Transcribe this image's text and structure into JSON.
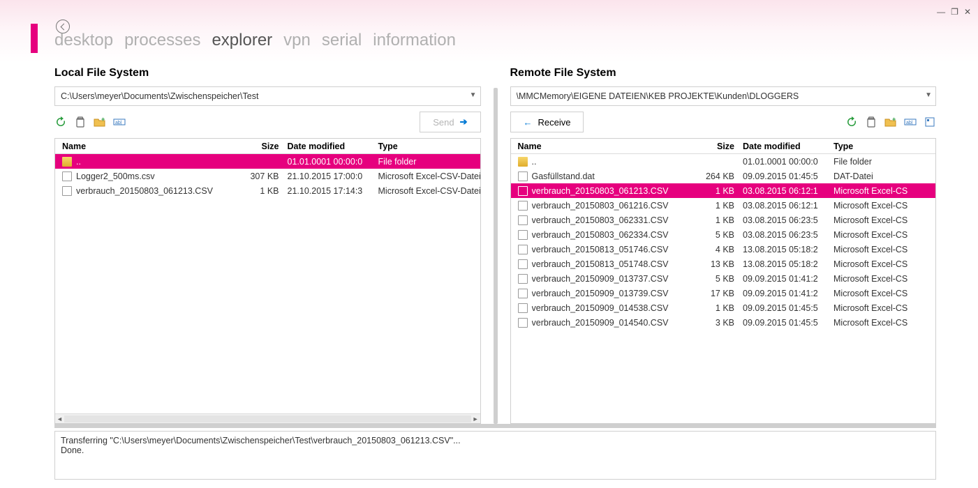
{
  "window": {
    "minimize": "—",
    "restore": "❐",
    "close": "✕"
  },
  "nav": {
    "items": [
      {
        "label": "desktop",
        "active": false
      },
      {
        "label": "processes",
        "active": false
      },
      {
        "label": "explorer",
        "active": true
      },
      {
        "label": "vpn",
        "active": false
      },
      {
        "label": "serial",
        "active": false
      },
      {
        "label": "information",
        "active": false
      }
    ]
  },
  "local": {
    "title": "Local File System",
    "path": "C:\\Users\\meyer\\Documents\\Zwischenspeicher\\Test",
    "send_label": "Send",
    "columns": {
      "name": "Name",
      "size": "Size",
      "date": "Date modified",
      "type": "Type"
    },
    "rows": [
      {
        "icon": "folder",
        "name": "..",
        "size": "",
        "date": "01.01.0001 00:00:0",
        "type": "File folder",
        "selected": true
      },
      {
        "icon": "file",
        "name": "Logger2_500ms.csv",
        "size": "307 KB",
        "date": "21.10.2015 17:00:0",
        "type": "Microsoft Excel-CSV-Datei",
        "selected": false
      },
      {
        "icon": "file",
        "name": "verbrauch_20150803_061213.CSV",
        "size": "1 KB",
        "date": "21.10.2015 17:14:3",
        "type": "Microsoft Excel-CSV-Datei",
        "selected": false
      }
    ]
  },
  "remote": {
    "title": "Remote File System",
    "path": "\\MMCMemory\\EIGENE DATEIEN\\KEB PROJEKTE\\Kunden\\DLOGGERS",
    "receive_label": "Receive",
    "columns": {
      "name": "Name",
      "size": "Size",
      "date": "Date modified",
      "type": "Type"
    },
    "rows": [
      {
        "icon": "folder",
        "name": "..",
        "size": "",
        "date": "01.01.0001 00:00:0",
        "type": "File folder",
        "selected": false
      },
      {
        "icon": "file",
        "name": "Gasfüllstand.dat",
        "size": "264 KB",
        "date": "09.09.2015 01:45:5",
        "type": "DAT-Datei",
        "selected": false
      },
      {
        "icon": "file",
        "name": "verbrauch_20150803_061213.CSV",
        "size": "1 KB",
        "date": "03.08.2015 06:12:1",
        "type": "Microsoft Excel-CS",
        "selected": true
      },
      {
        "icon": "file",
        "name": "verbrauch_20150803_061216.CSV",
        "size": "1 KB",
        "date": "03.08.2015 06:12:1",
        "type": "Microsoft Excel-CS",
        "selected": false
      },
      {
        "icon": "file",
        "name": "verbrauch_20150803_062331.CSV",
        "size": "1 KB",
        "date": "03.08.2015 06:23:5",
        "type": "Microsoft Excel-CS",
        "selected": false
      },
      {
        "icon": "file",
        "name": "verbrauch_20150803_062334.CSV",
        "size": "5 KB",
        "date": "03.08.2015 06:23:5",
        "type": "Microsoft Excel-CS",
        "selected": false
      },
      {
        "icon": "file",
        "name": "verbrauch_20150813_051746.CSV",
        "size": "4 KB",
        "date": "13.08.2015 05:18:2",
        "type": "Microsoft Excel-CS",
        "selected": false
      },
      {
        "icon": "file",
        "name": "verbrauch_20150813_051748.CSV",
        "size": "13 KB",
        "date": "13.08.2015 05:18:2",
        "type": "Microsoft Excel-CS",
        "selected": false
      },
      {
        "icon": "file",
        "name": "verbrauch_20150909_013737.CSV",
        "size": "5 KB",
        "date": "09.09.2015 01:41:2",
        "type": "Microsoft Excel-CS",
        "selected": false
      },
      {
        "icon": "file",
        "name": "verbrauch_20150909_013739.CSV",
        "size": "17 KB",
        "date": "09.09.2015 01:41:2",
        "type": "Microsoft Excel-CS",
        "selected": false
      },
      {
        "icon": "file",
        "name": "verbrauch_20150909_014538.CSV",
        "size": "1 KB",
        "date": "09.09.2015 01:45:5",
        "type": "Microsoft Excel-CS",
        "selected": false
      },
      {
        "icon": "file",
        "name": "verbrauch_20150909_014540.CSV",
        "size": "3 KB",
        "date": "09.09.2015 01:45:5",
        "type": "Microsoft Excel-CS",
        "selected": false
      }
    ]
  },
  "log": {
    "line1": "Transferring \"C:\\Users\\meyer\\Documents\\Zwischenspeicher\\Test\\verbrauch_20150803_061213.CSV\"...",
    "line2": "Done."
  },
  "icons": {
    "refresh": "refresh-icon",
    "delete": "delete-icon",
    "newfolder": "new-folder-icon",
    "rename": "rename-icon"
  }
}
